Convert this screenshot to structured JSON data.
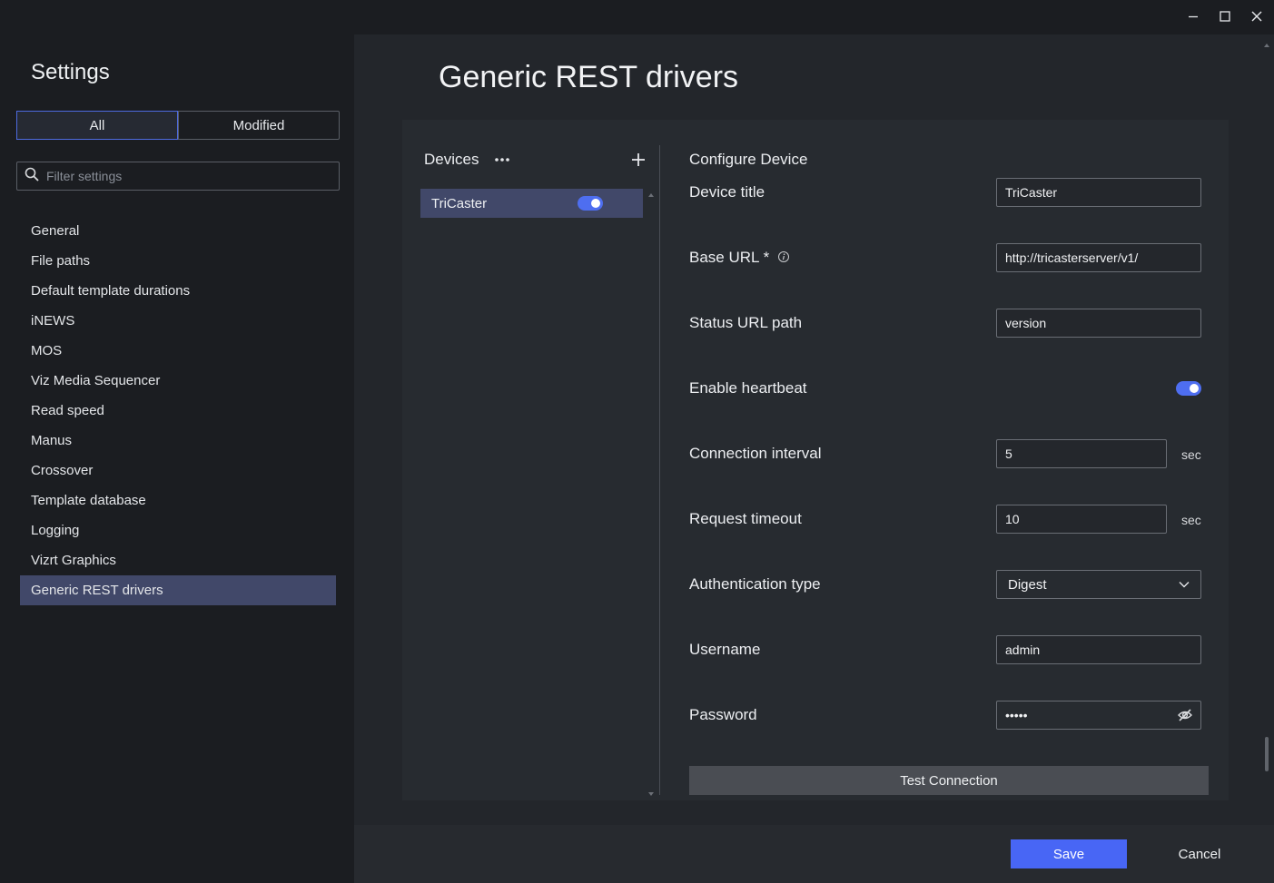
{
  "window": {
    "controls": [
      "minimize-icon",
      "maximize-icon",
      "close-icon"
    ]
  },
  "sidebar": {
    "title": "Settings",
    "filter_tabs": [
      {
        "label": "All",
        "active": true
      },
      {
        "label": "Modified",
        "active": false
      }
    ],
    "filter": {
      "placeholder": "Filter settings",
      "icon": "search-icon"
    },
    "items": [
      {
        "label": "General"
      },
      {
        "label": "File paths"
      },
      {
        "label": "Default template durations"
      },
      {
        "label": "iNEWS"
      },
      {
        "label": "MOS"
      },
      {
        "label": "Viz Media Sequencer"
      },
      {
        "label": "Read speed"
      },
      {
        "label": "Manus"
      },
      {
        "label": "Crossover"
      },
      {
        "label": "Template database"
      },
      {
        "label": "Logging"
      },
      {
        "label": "Vizrt Graphics"
      },
      {
        "label": "Generic REST drivers",
        "active": true
      }
    ]
  },
  "main": {
    "title": "Generic REST drivers",
    "devices": {
      "label": "Devices",
      "items": [
        {
          "name": "TriCaster",
          "enabled": true,
          "selected": true
        }
      ]
    },
    "configure": {
      "title": "Configure Device",
      "device_title": {
        "label": "Device title",
        "value": "TriCaster"
      },
      "base_url": {
        "label": "Base URL *",
        "value": "http://tricasterserver/v1/"
      },
      "status_url_path": {
        "label": "Status URL path",
        "value": "version"
      },
      "enable_heartbeat": {
        "label": "Enable heartbeat",
        "enabled": true
      },
      "connection_interval": {
        "label": "Connection interval",
        "value": "5",
        "unit": "sec"
      },
      "request_timeout": {
        "label": "Request timeout",
        "value": "10",
        "unit": "sec"
      },
      "authentication_type": {
        "label": "Authentication type",
        "value": "Digest"
      },
      "username": {
        "label": "Username",
        "value": "admin"
      },
      "password": {
        "label": "Password",
        "value": "•••••"
      },
      "test_button": "Test Connection"
    }
  },
  "footer": {
    "save_label": "Save",
    "cancel_label": "Cancel"
  },
  "colors": {
    "accent": "#4866f5",
    "selected_row": "#414869",
    "toggle_on": "#4e6ef0"
  }
}
